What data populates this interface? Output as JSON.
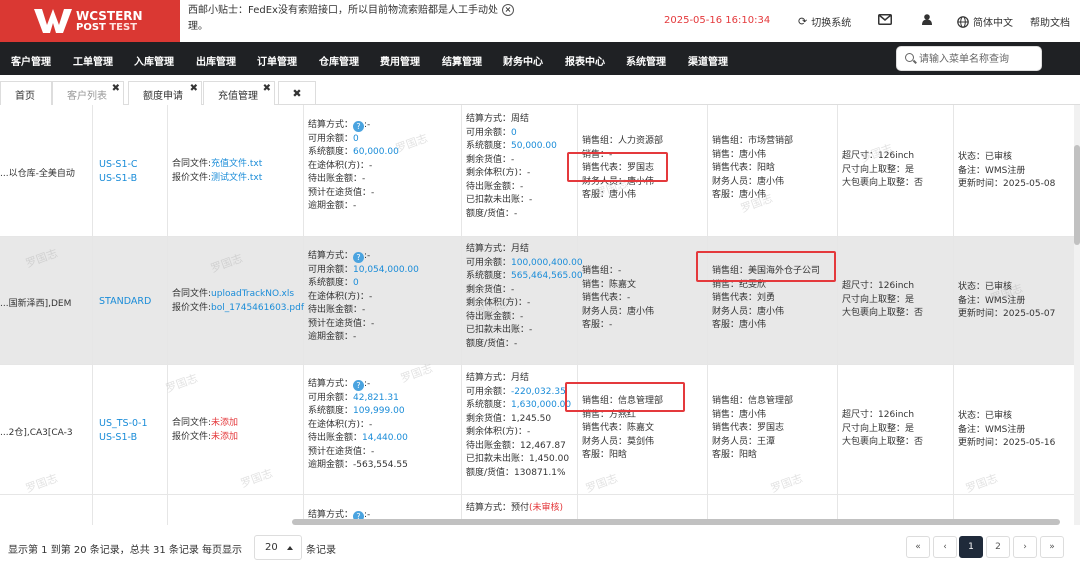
{
  "brand": {
    "line1": "WCSTERN",
    "line2_a": "POST",
    "line2_b": "TEST"
  },
  "tip": "西邮小贴士：FedEx没有索赔接口，所以目前物流索赔都是人工手动处理。",
  "datetime": "2025-05-16 16:10:34",
  "topbar": {
    "switch": "切换系统",
    "lang": "简体中文",
    "help": "帮助文档"
  },
  "nav": {
    "items": [
      "客户管理",
      "工单管理",
      "入库管理",
      "出库管理",
      "订单管理",
      "仓库管理",
      "费用管理",
      "结算管理",
      "财务中心",
      "报表中心",
      "系统管理",
      "渠道管理"
    ],
    "search_placeholder": "请输入菜单名称查询"
  },
  "tabs": [
    {
      "label": "首页"
    },
    {
      "label": "客户列表"
    },
    {
      "label": "额度申请"
    },
    {
      "label": "充值管理"
    }
  ],
  "rows": [
    {
      "name": "以仓库-全美自动...",
      "codes": [
        "US-S1-C",
        "US-S1-B"
      ],
      "files": {
        "contract_label": "合同文件:",
        "contract": "充值文件.txt",
        "quote_label": "报价文件:",
        "quote": "测试文件.txt"
      },
      "bal": {
        "method": "结算方式：",
        "method_val": ":-",
        "lines": [
          {
            "k": "可用余额：",
            "v": "0",
            "c": "blue"
          },
          {
            "k": "系统额度：",
            "v": "60,000.00",
            "c": "blue"
          },
          {
            "k": "在途体积(方)：",
            "v": "-",
            "c": ""
          },
          {
            "k": "待出账金额：",
            "v": "-",
            "c": ""
          },
          {
            "k": "预计在途货值：",
            "v": "-",
            "c": ""
          },
          {
            "k": "逾期金额：",
            "v": "-",
            "c": ""
          }
        ]
      },
      "settle": [
        {
          "k": "结算方式：",
          "v": "周结",
          "c": ""
        },
        {
          "k": "可用余额：",
          "v": "0",
          "c": "blue"
        },
        {
          "k": "系统额度：",
          "v": "50,000.00",
          "c": "blue"
        },
        {
          "k": "剩余货值：",
          "v": "-",
          "c": ""
        },
        {
          "k": "剩余体积(方)：",
          "v": "-",
          "c": ""
        },
        {
          "k": "待出账金额：",
          "v": "-",
          "c": ""
        },
        {
          "k": "已扣款未出账：",
          "v": "-",
          "c": ""
        },
        {
          "k": "额度/货值：",
          "v": "-",
          "c": ""
        }
      ],
      "sales": [
        {
          "k": "销售组：",
          "v": "人力资源部"
        },
        {
          "k": "销售：",
          "v": "-"
        },
        {
          "k": "销售代表：",
          "v": "罗国志"
        },
        {
          "k": "财务人员：",
          "v": "唐小伟"
        },
        {
          "k": "客服：",
          "v": "唐小伟"
        }
      ],
      "sales2": [
        {
          "k": "销售组：",
          "v": "市场营销部"
        },
        {
          "k": "销售：",
          "v": "唐小伟"
        },
        {
          "k": "销售代表：",
          "v": "阳晗"
        },
        {
          "k": "财务人员：",
          "v": "唐小伟"
        },
        {
          "k": "客服：",
          "v": "唐小伟"
        }
      ],
      "dims": [
        {
          "k": "超尺寸：",
          "v": "126inch"
        },
        {
          "k": "尺寸向上取整：",
          "v": "是"
        },
        {
          "k": "大包裹向上取整：",
          "v": "否"
        }
      ],
      "status": [
        {
          "k": "状态：",
          "v": "已审核"
        },
        {
          "k": "备注：",
          "v": "WMS注册"
        },
        {
          "k": "更新时间：",
          "v": "2025-05-08"
        }
      ]
    },
    {
      "name": "国新泽西],DEM...",
      "codes": [
        "STANDARD"
      ],
      "files": {
        "contract_label": "合同文件:",
        "contract": "uploadTrackNO.xls",
        "quote_label": "报价文件:",
        "quote": "bol_1745461603.pdf"
      },
      "bal": {
        "method": "结算方式：",
        "method_val": ":-",
        "lines": [
          {
            "k": "可用余额：",
            "v": "10,054,000.00",
            "c": "blue"
          },
          {
            "k": "系统额度：",
            "v": "0",
            "c": "blue"
          },
          {
            "k": "在途体积(方)：",
            "v": "-",
            "c": ""
          },
          {
            "k": "待出账金额：",
            "v": "-",
            "c": ""
          },
          {
            "k": "预计在途货值：",
            "v": "-",
            "c": ""
          },
          {
            "k": "逾期金额：",
            "v": "-",
            "c": ""
          }
        ]
      },
      "settle": [
        {
          "k": "结算方式：",
          "v": "月结",
          "c": ""
        },
        {
          "k": "可用余额：",
          "v": "100,000,400.00",
          "c": "blue"
        },
        {
          "k": "系统额度：",
          "v": "565,464,565.00",
          "c": "blue"
        },
        {
          "k": "剩余货值：",
          "v": "-",
          "c": ""
        },
        {
          "k": "剩余体积(方)：",
          "v": "-",
          "c": ""
        },
        {
          "k": "待出账金额：",
          "v": "-",
          "c": ""
        },
        {
          "k": "已扣款未出账：",
          "v": "-",
          "c": ""
        },
        {
          "k": "额度/货值：",
          "v": "-",
          "c": ""
        }
      ],
      "sales": [
        {
          "k": "销售组：",
          "v": "-"
        },
        {
          "k": "销售：",
          "v": "陈嘉文"
        },
        {
          "k": "销售代表：",
          "v": "-"
        },
        {
          "k": "财务人员：",
          "v": "唐小伟"
        },
        {
          "k": "客服：",
          "v": "-"
        }
      ],
      "sales2": [
        {
          "k": "销售组：",
          "v": "美国海外仓子公司"
        },
        {
          "k": "销售：",
          "v": "纪雯欣"
        },
        {
          "k": "销售代表：",
          "v": "刘勇"
        },
        {
          "k": "财务人员：",
          "v": "唐小伟"
        },
        {
          "k": "客服：",
          "v": "唐小伟"
        }
      ],
      "dims": [
        {
          "k": "超尺寸：",
          "v": "126inch"
        },
        {
          "k": "尺寸向上取整：",
          "v": "是"
        },
        {
          "k": "大包裹向上取整：",
          "v": "否"
        }
      ],
      "status": [
        {
          "k": "状态：",
          "v": "已审核"
        },
        {
          "k": "备注：",
          "v": "WMS注册"
        },
        {
          "k": "更新时间：",
          "v": "2025-05-07"
        }
      ]
    },
    {
      "name": "2仓],CA3[CA-3...",
      "codes": [
        "US_TS-0-1",
        "US-S1-B"
      ],
      "files": {
        "contract_label": "合同文件:",
        "contract": "未添加",
        "quote_label": "报价文件:",
        "quote": "未添加"
      },
      "bal": {
        "method": "结算方式：",
        "method_val": ":-",
        "lines": [
          {
            "k": "可用余额：",
            "v": "42,821.31",
            "c": "blue"
          },
          {
            "k": "系统额度：",
            "v": "109,999.00",
            "c": "blue"
          },
          {
            "k": "在途体积(方)：",
            "v": "-",
            "c": ""
          },
          {
            "k": "待出账金额：",
            "v": "14,440.00",
            "c": "blue"
          },
          {
            "k": "预计在途货值：",
            "v": "-",
            "c": ""
          },
          {
            "k": "逾期金额：",
            "v": "-563,554.55",
            "c": ""
          }
        ]
      },
      "settle": [
        {
          "k": "结算方式：",
          "v": "月结",
          "c": ""
        },
        {
          "k": "可用余额：",
          "v": "-220,032.35",
          "c": "blue"
        },
        {
          "k": "系统额度：",
          "v": "1,630,000.00",
          "c": "blue"
        },
        {
          "k": "剩余货值：",
          "v": "1,245.50",
          "c": ""
        },
        {
          "k": "剩余体积(方)：",
          "v": "-",
          "c": ""
        },
        {
          "k": "待出账金额：",
          "v": "12,467.87",
          "c": ""
        },
        {
          "k": "已扣款未出账：",
          "v": "1,450.00",
          "c": ""
        },
        {
          "k": "额度/货值：",
          "v": "130871.1%",
          "c": ""
        }
      ],
      "sales": [
        {
          "k": "销售组：",
          "v": "信息管理部"
        },
        {
          "k": "销售：",
          "v": "方燕红"
        },
        {
          "k": "销售代表：",
          "v": "陈嘉文"
        },
        {
          "k": "财务人员：",
          "v": "莫剑伟"
        },
        {
          "k": "客服：",
          "v": "阳晗"
        }
      ],
      "sales2": [
        {
          "k": "销售组：",
          "v": "信息管理部"
        },
        {
          "k": "销售：",
          "v": "唐小伟"
        },
        {
          "k": "销售代表：",
          "v": "罗国志"
        },
        {
          "k": "财务人员：",
          "v": "王潭"
        },
        {
          "k": "客服：",
          "v": "阳晗"
        }
      ],
      "dims": [
        {
          "k": "超尺寸：",
          "v": "126inch"
        },
        {
          "k": "尺寸向上取整：",
          "v": "是"
        },
        {
          "k": "大包裹向上取整：",
          "v": "否"
        }
      ],
      "status": [
        {
          "k": "状态：",
          "v": "已审核"
        },
        {
          "k": "备注：",
          "v": "WMS注册"
        },
        {
          "k": "更新时间：",
          "v": "2025-05-16"
        }
      ]
    },
    {
      "bal_method": "结算方式：",
      "bal_method_val": ":-",
      "settle_method": "结算方式：预付",
      "settle_flag": "(未审核)"
    }
  ],
  "watermark": "罗国志",
  "footer": {
    "summary": "显示第 1 到第 20 条记录，总共 31 条记录 每页显示",
    "page_size": "20",
    "suffix": "条记录",
    "pages": [
      "«",
      "‹",
      "1",
      "2",
      "›",
      "»"
    ]
  },
  "colors": {
    "brand": "#da3833",
    "nav": "#1f2124",
    "link": "#1a8cd8",
    "alert": "#e4393c"
  }
}
